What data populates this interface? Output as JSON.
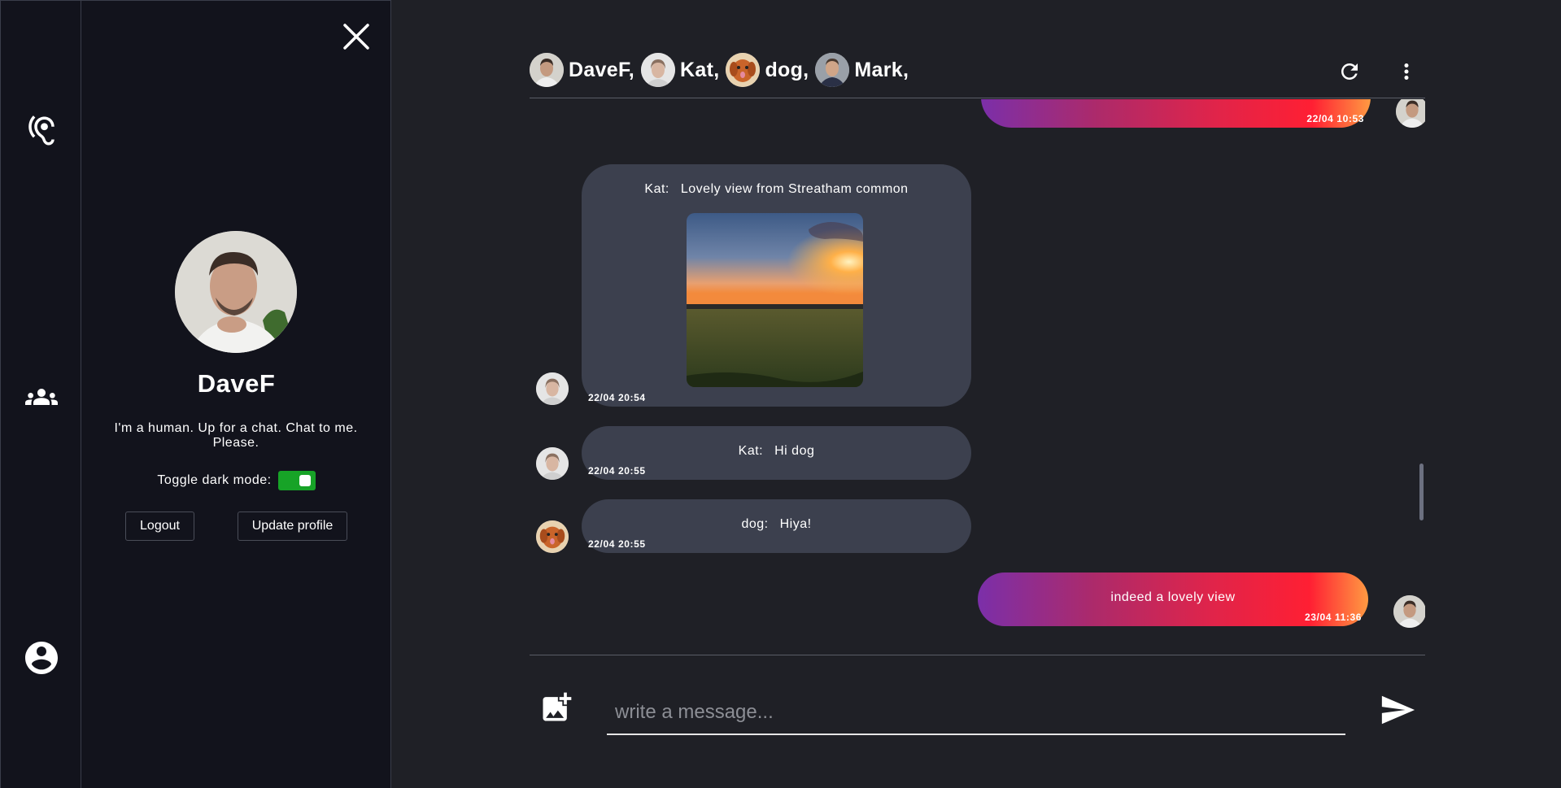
{
  "rail": {
    "icons": [
      "hearing-icon",
      "group-icon",
      "account-icon"
    ]
  },
  "profile": {
    "name": "DaveF",
    "bio": "I'm a human. Up for a chat. Chat to me. Please.",
    "dark_mode_label": "Toggle dark mode:",
    "dark_mode_on": true,
    "logout_label": "Logout",
    "update_label": "Update profile"
  },
  "header": {
    "participants": [
      {
        "name": "DaveF,"
      },
      {
        "name": "Kat,"
      },
      {
        "name": "dog,"
      },
      {
        "name": "Mark,"
      }
    ]
  },
  "messages": [
    {
      "direction": "out",
      "sender": "",
      "text": "",
      "timestamp": "22/04 10:53"
    },
    {
      "direction": "in",
      "sender": "Kat:",
      "text": "Lovely view from Streatham common",
      "timestamp": "22/04 20:54",
      "has_image": true
    },
    {
      "direction": "in",
      "sender": "Kat:",
      "text": "Hi dog",
      "timestamp": "22/04 20:55"
    },
    {
      "direction": "in",
      "sender": "dog:",
      "text": "Hiya!",
      "timestamp": "22/04 20:55"
    },
    {
      "direction": "out",
      "sender": "",
      "text": "indeed a lovely view",
      "timestamp": "23/04 11:36"
    }
  ],
  "composer": {
    "placeholder": "write a message..."
  },
  "colors": {
    "background": "#1f2026",
    "panel": "#12131c",
    "bubble_in": "#3c404e",
    "toggle_on": "#17a327",
    "bubble_out_gradient": [
      "#7b2fa9",
      "#e0244a",
      "#ff1f33",
      "#ff9a42"
    ]
  }
}
